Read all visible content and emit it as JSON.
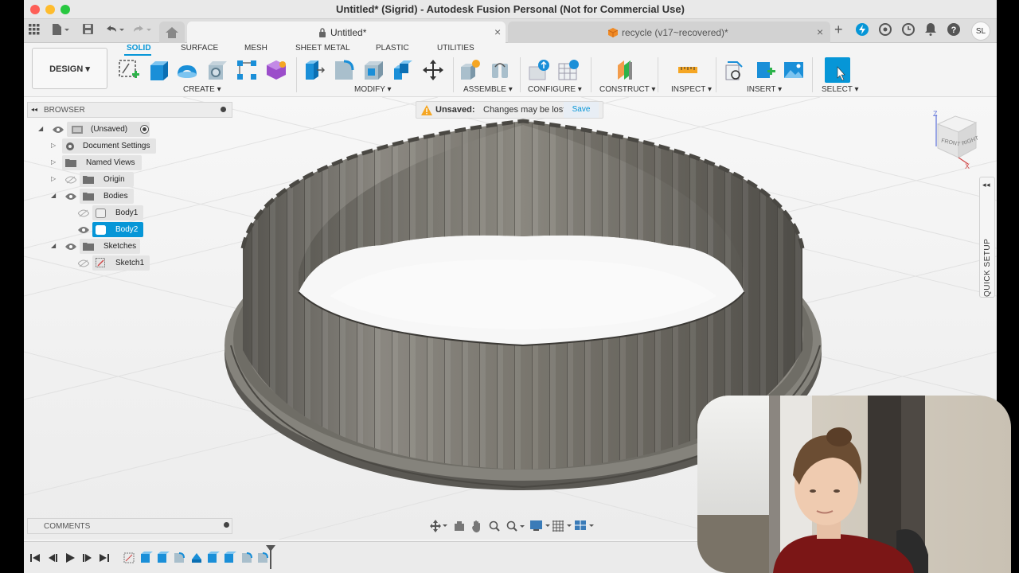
{
  "window": {
    "title": "Untitled* (Sigrid) - Autodesk Fusion Personal (Not for Commercial Use)",
    "colors": {
      "close": "#fe5f57",
      "minimize": "#febc2e",
      "maximize": "#28c840",
      "accent": "#0696d7"
    }
  },
  "tabs": [
    {
      "label": "Untitled*",
      "icon": "lock-icon"
    },
    {
      "label": "recycle (v17~recovered)*",
      "icon": "cube-icon"
    }
  ],
  "user": {
    "initials": "SL"
  },
  "ribbon": {
    "workspace": "DESIGN",
    "tabs": [
      "SOLID",
      "SURFACE",
      "MESH",
      "SHEET METAL",
      "PLASTIC",
      "UTILITIES"
    ],
    "groups": [
      "CREATE",
      "MODIFY",
      "ASSEMBLE",
      "CONFIGURE",
      "CONSTRUCT",
      "INSPECT",
      "INSERT",
      "SELECT"
    ]
  },
  "browser": {
    "title": "BROWSER",
    "items": [
      {
        "label": "(Unsaved)"
      },
      {
        "label": "Document Settings"
      },
      {
        "label": "Named Views"
      },
      {
        "label": "Origin"
      },
      {
        "label": "Bodies"
      },
      {
        "label": "Body1"
      },
      {
        "label": "Body2"
      },
      {
        "label": "Sketches"
      },
      {
        "label": "Sketch1"
      }
    ]
  },
  "banner": {
    "status": "Unsaved:",
    "message": "Changes may be lost",
    "action": "Save"
  },
  "viewcube": {
    "front": "FRONT",
    "right": "RIGHT",
    "z": "Z",
    "x": "X"
  },
  "panels": {
    "comments": "COMMENTS",
    "quick_setup": "QUICK SETUP"
  }
}
